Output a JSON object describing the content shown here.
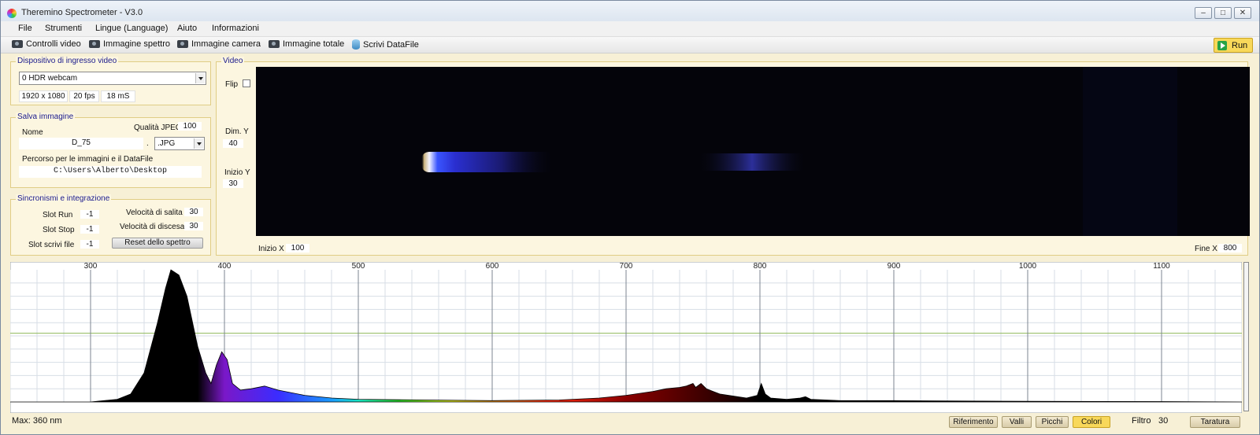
{
  "window": {
    "title": "Theremino Spectrometer - V3.0"
  },
  "menu": [
    "File",
    "Strumenti",
    "Lingue (Language)",
    "Aiuto",
    "Informazioni"
  ],
  "toolbar": {
    "buttons": [
      "Controlli video",
      "Immagine spettro",
      "Immagine camera",
      "Immagine totale",
      "Scrivi DataFile"
    ],
    "run_label": "Run"
  },
  "device": {
    "title": "Dispositivo di ingresso video",
    "selected": "0 HDR webcam",
    "resolution": "1920 x 1080",
    "fps": "20 fps",
    "ms": "18 mS"
  },
  "save": {
    "title": "Salva immagine",
    "name_label": "Nome",
    "quality_label": "Qualità JPEG",
    "quality_value": "100",
    "name_value": "D_75",
    "dot": ".",
    "format": ".JPG",
    "path_label": "Percorso per le immagini e il DataFile",
    "path_value": "C:\\Users\\Alberto\\Desktop"
  },
  "sync": {
    "title": "Sincronismi e integrazione",
    "slot_run_label": "Slot Run",
    "slot_run": "-1",
    "slot_stop_label": "Slot Stop",
    "slot_stop": "-1",
    "slot_write_label": "Slot scrivi file",
    "slot_write": "-1",
    "rise_label": "Velocità di salita",
    "rise": "30",
    "fall_label": "Velocità di discesa",
    "fall": "30",
    "reset_label": "Reset dello spettro"
  },
  "video": {
    "title": "Video",
    "flip_label": "Flip",
    "dim_y_label": "Dim. Y",
    "dim_y": "40",
    "start_y_label": "Inizio Y",
    "start_y": "30",
    "start_x_label": "Inizio X",
    "start_x": "100",
    "end_x_label": "Fine X",
    "end_x": "800"
  },
  "chart_data": {
    "type": "area",
    "xlabel": "",
    "ylabel": "",
    "xlim": [
      240,
      1160
    ],
    "ticks": [
      300,
      400,
      500,
      600,
      700,
      800,
      900,
      1000,
      1100
    ],
    "x": [
      240,
      300,
      320,
      330,
      340,
      350,
      356,
      360,
      366,
      372,
      380,
      386,
      390,
      394,
      398,
      402,
      406,
      412,
      420,
      430,
      440,
      460,
      480,
      500,
      550,
      600,
      650,
      680,
      700,
      720,
      730,
      740,
      745,
      750,
      752,
      756,
      760,
      765,
      770,
      790,
      798,
      801,
      804,
      808,
      820,
      830,
      834,
      838,
      860,
      900,
      1000,
      1100,
      1160
    ],
    "values": [
      0,
      0,
      2,
      6,
      22,
      60,
      86,
      100,
      96,
      80,
      42,
      22,
      14,
      28,
      38,
      32,
      14,
      9,
      10,
      12,
      9,
      5,
      3,
      2,
      1.5,
      1,
      1.5,
      3,
      5,
      8,
      10,
      11,
      12,
      14,
      11,
      14,
      10,
      8,
      6,
      3,
      5,
      14,
      6,
      3,
      2,
      3,
      4,
      2,
      1,
      1,
      0.5,
      0.3,
      0
    ],
    "ylim": [
      0,
      100
    ],
    "grid": true
  },
  "status": {
    "max_text": "Max: 360 nm",
    "buttons": [
      "Riferimento",
      "Valli",
      "Picchi",
      "Colori"
    ],
    "active_button": "Colori",
    "filter_label": "Filtro",
    "filter_value": "30",
    "calibrate_label": "Taratura"
  }
}
